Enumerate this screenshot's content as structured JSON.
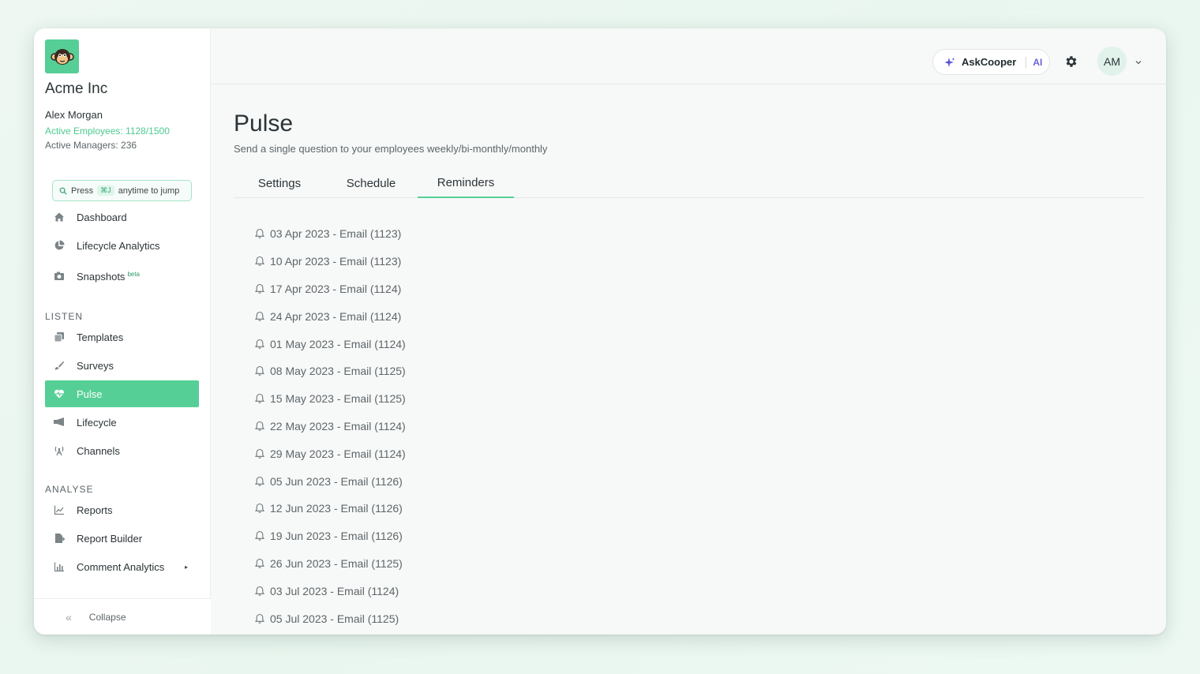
{
  "sidebar": {
    "company": "Acme Inc",
    "user_name": "Alex Morgan",
    "active_employees": "Active Employees: 1128/1500",
    "active_managers": "Active Managers: 236",
    "search": {
      "prefix": "Press",
      "shortcut": "⌘J",
      "suffix": "anytime to jump"
    },
    "items_top": [
      {
        "label": "Dashboard",
        "icon": "home-icon"
      },
      {
        "label": "Lifecycle Analytics",
        "icon": "pie-chart-icon"
      },
      {
        "label": "Snapshots",
        "badge": "beta",
        "icon": "camera-icon"
      }
    ],
    "section_listen": "LISTEN",
    "items_listen": [
      {
        "label": "Templates",
        "icon": "copy-icon"
      },
      {
        "label": "Surveys",
        "icon": "brush-icon"
      },
      {
        "label": "Pulse",
        "icon": "heart-pulse-icon",
        "active": true
      },
      {
        "label": "Lifecycle",
        "icon": "megaphone-icon"
      },
      {
        "label": "Channels",
        "icon": "broadcast-icon"
      }
    ],
    "section_analyse": "ANALYSE",
    "items_analyse": [
      {
        "label": "Reports",
        "icon": "line-chart-icon"
      },
      {
        "label": "Report Builder",
        "icon": "file-export-icon"
      },
      {
        "label": "Comment Analytics",
        "icon": "bar-chart-icon"
      }
    ],
    "collapse_label": "Collapse"
  },
  "topbar": {
    "ask_label": "AskCooper",
    "ai_label": "AI",
    "avatar_initials": "AM"
  },
  "page": {
    "title": "Pulse",
    "subtitle": "Send a single question to your employees weekly/bi-monthly/monthly",
    "tabs": [
      "Settings",
      "Schedule",
      "Reminders"
    ],
    "active_tab": "Reminders"
  },
  "reminders": [
    "03 Apr 2023 - Email (1123)",
    "10 Apr 2023 - Email (1123)",
    "17 Apr 2023 - Email (1124)",
    "24 Apr 2023 - Email (1124)",
    "01 May 2023 - Email (1124)",
    "08 May 2023 - Email (1125)",
    "15 May 2023 - Email (1125)",
    "22 May 2023 - Email (1124)",
    "29 May 2023 - Email (1124)",
    "05 Jun 2023 - Email (1126)",
    "12 Jun 2023 - Email (1126)",
    "19 Jun 2023 - Email (1126)",
    "26 Jun 2023 - Email (1125)",
    "03 Jul 2023 - Email (1124)",
    "05 Jul 2023 - Email (1125)"
  ],
  "colors": {
    "accent": "#56cf96",
    "ai": "#6b63d9"
  }
}
